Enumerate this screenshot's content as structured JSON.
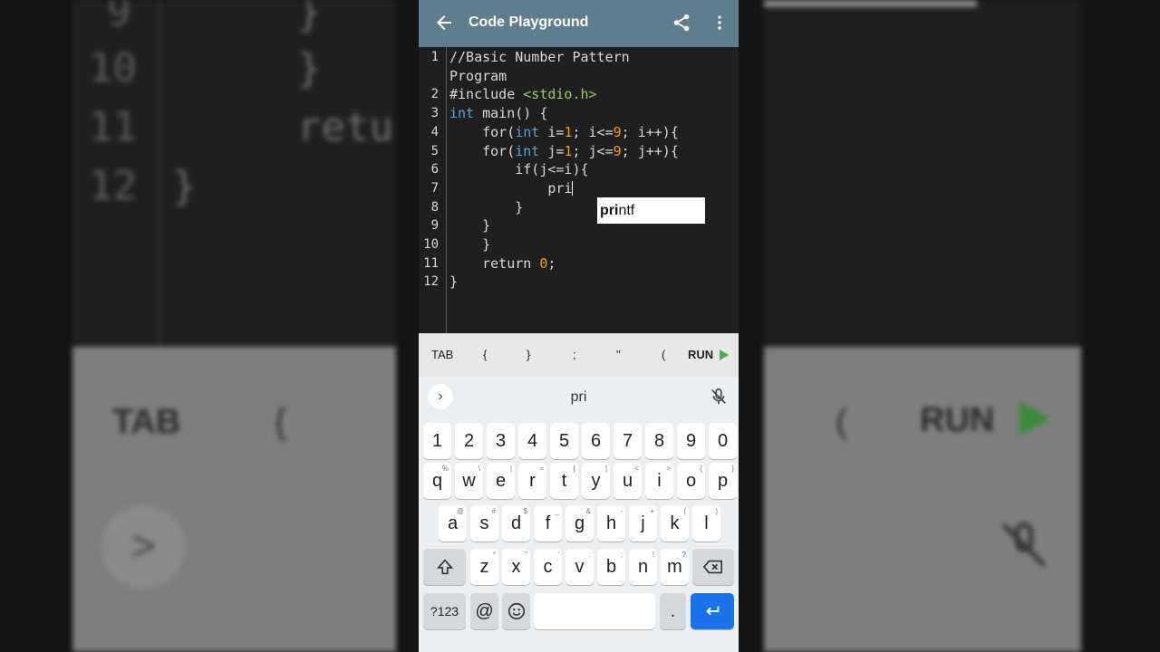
{
  "app": {
    "title": "Code Playground",
    "back_icon": "arrow-left-icon",
    "share_icon": "share-icon",
    "more_icon": "more-vert-icon"
  },
  "editor": {
    "lines": [
      {
        "n": "1",
        "segments": [
          [
            "plain",
            "//Basic Number Pattern"
          ]
        ]
      },
      {
        "n": "",
        "segments": [
          [
            "plain",
            "Program"
          ]
        ]
      },
      {
        "n": "2",
        "segments": [
          [
            "plain",
            "#include "
          ],
          [
            "str",
            "<stdio.h>"
          ]
        ]
      },
      {
        "n": "3",
        "segments": [
          [
            "kw",
            "int"
          ],
          [
            "plain",
            " main() {"
          ]
        ]
      },
      {
        "n": "4",
        "segments": [
          [
            "plain",
            "    for("
          ],
          [
            "kw",
            "int"
          ],
          [
            "plain",
            " i="
          ],
          [
            "num",
            "1"
          ],
          [
            "plain",
            "; i<="
          ],
          [
            "num",
            "9"
          ],
          [
            "plain",
            "; i++){"
          ]
        ]
      },
      {
        "n": "5",
        "segments": [
          [
            "plain",
            "    for("
          ],
          [
            "kw",
            "int"
          ],
          [
            "plain",
            " j="
          ],
          [
            "num",
            "1"
          ],
          [
            "plain",
            "; j<="
          ],
          [
            "num",
            "9"
          ],
          [
            "plain",
            "; j++){"
          ]
        ]
      },
      {
        "n": "6",
        "segments": [
          [
            "plain",
            "        if(j<=i){"
          ]
        ]
      },
      {
        "n": "7",
        "segments": [
          [
            "plain",
            "            pri"
          ]
        ]
      },
      {
        "n": "8",
        "segments": [
          [
            "plain",
            "        }"
          ]
        ]
      },
      {
        "n": "9",
        "segments": [
          [
            "plain",
            "    }"
          ]
        ]
      },
      {
        "n": "10",
        "segments": [
          [
            "plain",
            "    }"
          ]
        ]
      },
      {
        "n": "11",
        "segments": [
          [
            "plain",
            "    return "
          ],
          [
            "num",
            "0"
          ],
          [
            "plain",
            ";"
          ]
        ]
      },
      {
        "n": "12",
        "segments": [
          [
            "plain",
            "}"
          ]
        ]
      }
    ],
    "autocomplete": {
      "match": "pri",
      "rest": "ntf"
    }
  },
  "accessory": {
    "keys": [
      "TAB",
      "{",
      "}",
      ";",
      "\"",
      "("
    ],
    "run_label": "RUN",
    "run_icon": "play-icon"
  },
  "keyboard": {
    "suggestion": "pri",
    "expand_icon": "chevron-right-icon",
    "mic_icon": "mic-off-icon",
    "numbers": [
      "1",
      "2",
      "3",
      "4",
      "5",
      "6",
      "7",
      "8",
      "9",
      "0"
    ],
    "row1": [
      {
        "k": "q",
        "h": "%"
      },
      {
        "k": "w",
        "h": "\\"
      },
      {
        "k": "e",
        "h": "|"
      },
      {
        "k": "r",
        "h": "="
      },
      {
        "k": "t",
        "h": "["
      },
      {
        "k": "y",
        "h": "]"
      },
      {
        "k": "u",
        "h": "<"
      },
      {
        "k": "i",
        "h": ">"
      },
      {
        "k": "o",
        "h": "{"
      },
      {
        "k": "p",
        "h": "}"
      }
    ],
    "row2": [
      {
        "k": "a",
        "h": "@"
      },
      {
        "k": "s",
        "h": "#"
      },
      {
        "k": "d",
        "h": "$"
      },
      {
        "k": "f",
        "h": "_"
      },
      {
        "k": "g",
        "h": "&"
      },
      {
        "k": "h",
        "h": "-"
      },
      {
        "k": "j",
        "h": "+"
      },
      {
        "k": "k",
        "h": "("
      },
      {
        "k": "l",
        "h": ")"
      }
    ],
    "row3": [
      {
        "k": "z",
        "h": "*"
      },
      {
        "k": "x",
        "h": "\""
      },
      {
        "k": "c",
        "h": "'"
      },
      {
        "k": "v",
        "h": ":"
      },
      {
        "k": "b",
        "h": ";"
      },
      {
        "k": "n",
        "h": "!"
      },
      {
        "k": "m",
        "h": "?"
      }
    ],
    "symbols_label": "?123",
    "at_label": "@",
    "period_label": ".",
    "shift_icon": "shift-icon",
    "backspace_icon": "backspace-icon",
    "emoji_icon": "emoji-icon",
    "enter_icon": "enter-icon"
  },
  "background": {
    "line_numbers": [
      "9",
      "10",
      "11",
      "12"
    ],
    "code_fragments": [
      "}",
      "}",
      "retu",
      "}"
    ],
    "left_labels": [
      "TAB",
      "{"
    ],
    "right_labels": [
      "(",
      "RUN"
    ]
  }
}
